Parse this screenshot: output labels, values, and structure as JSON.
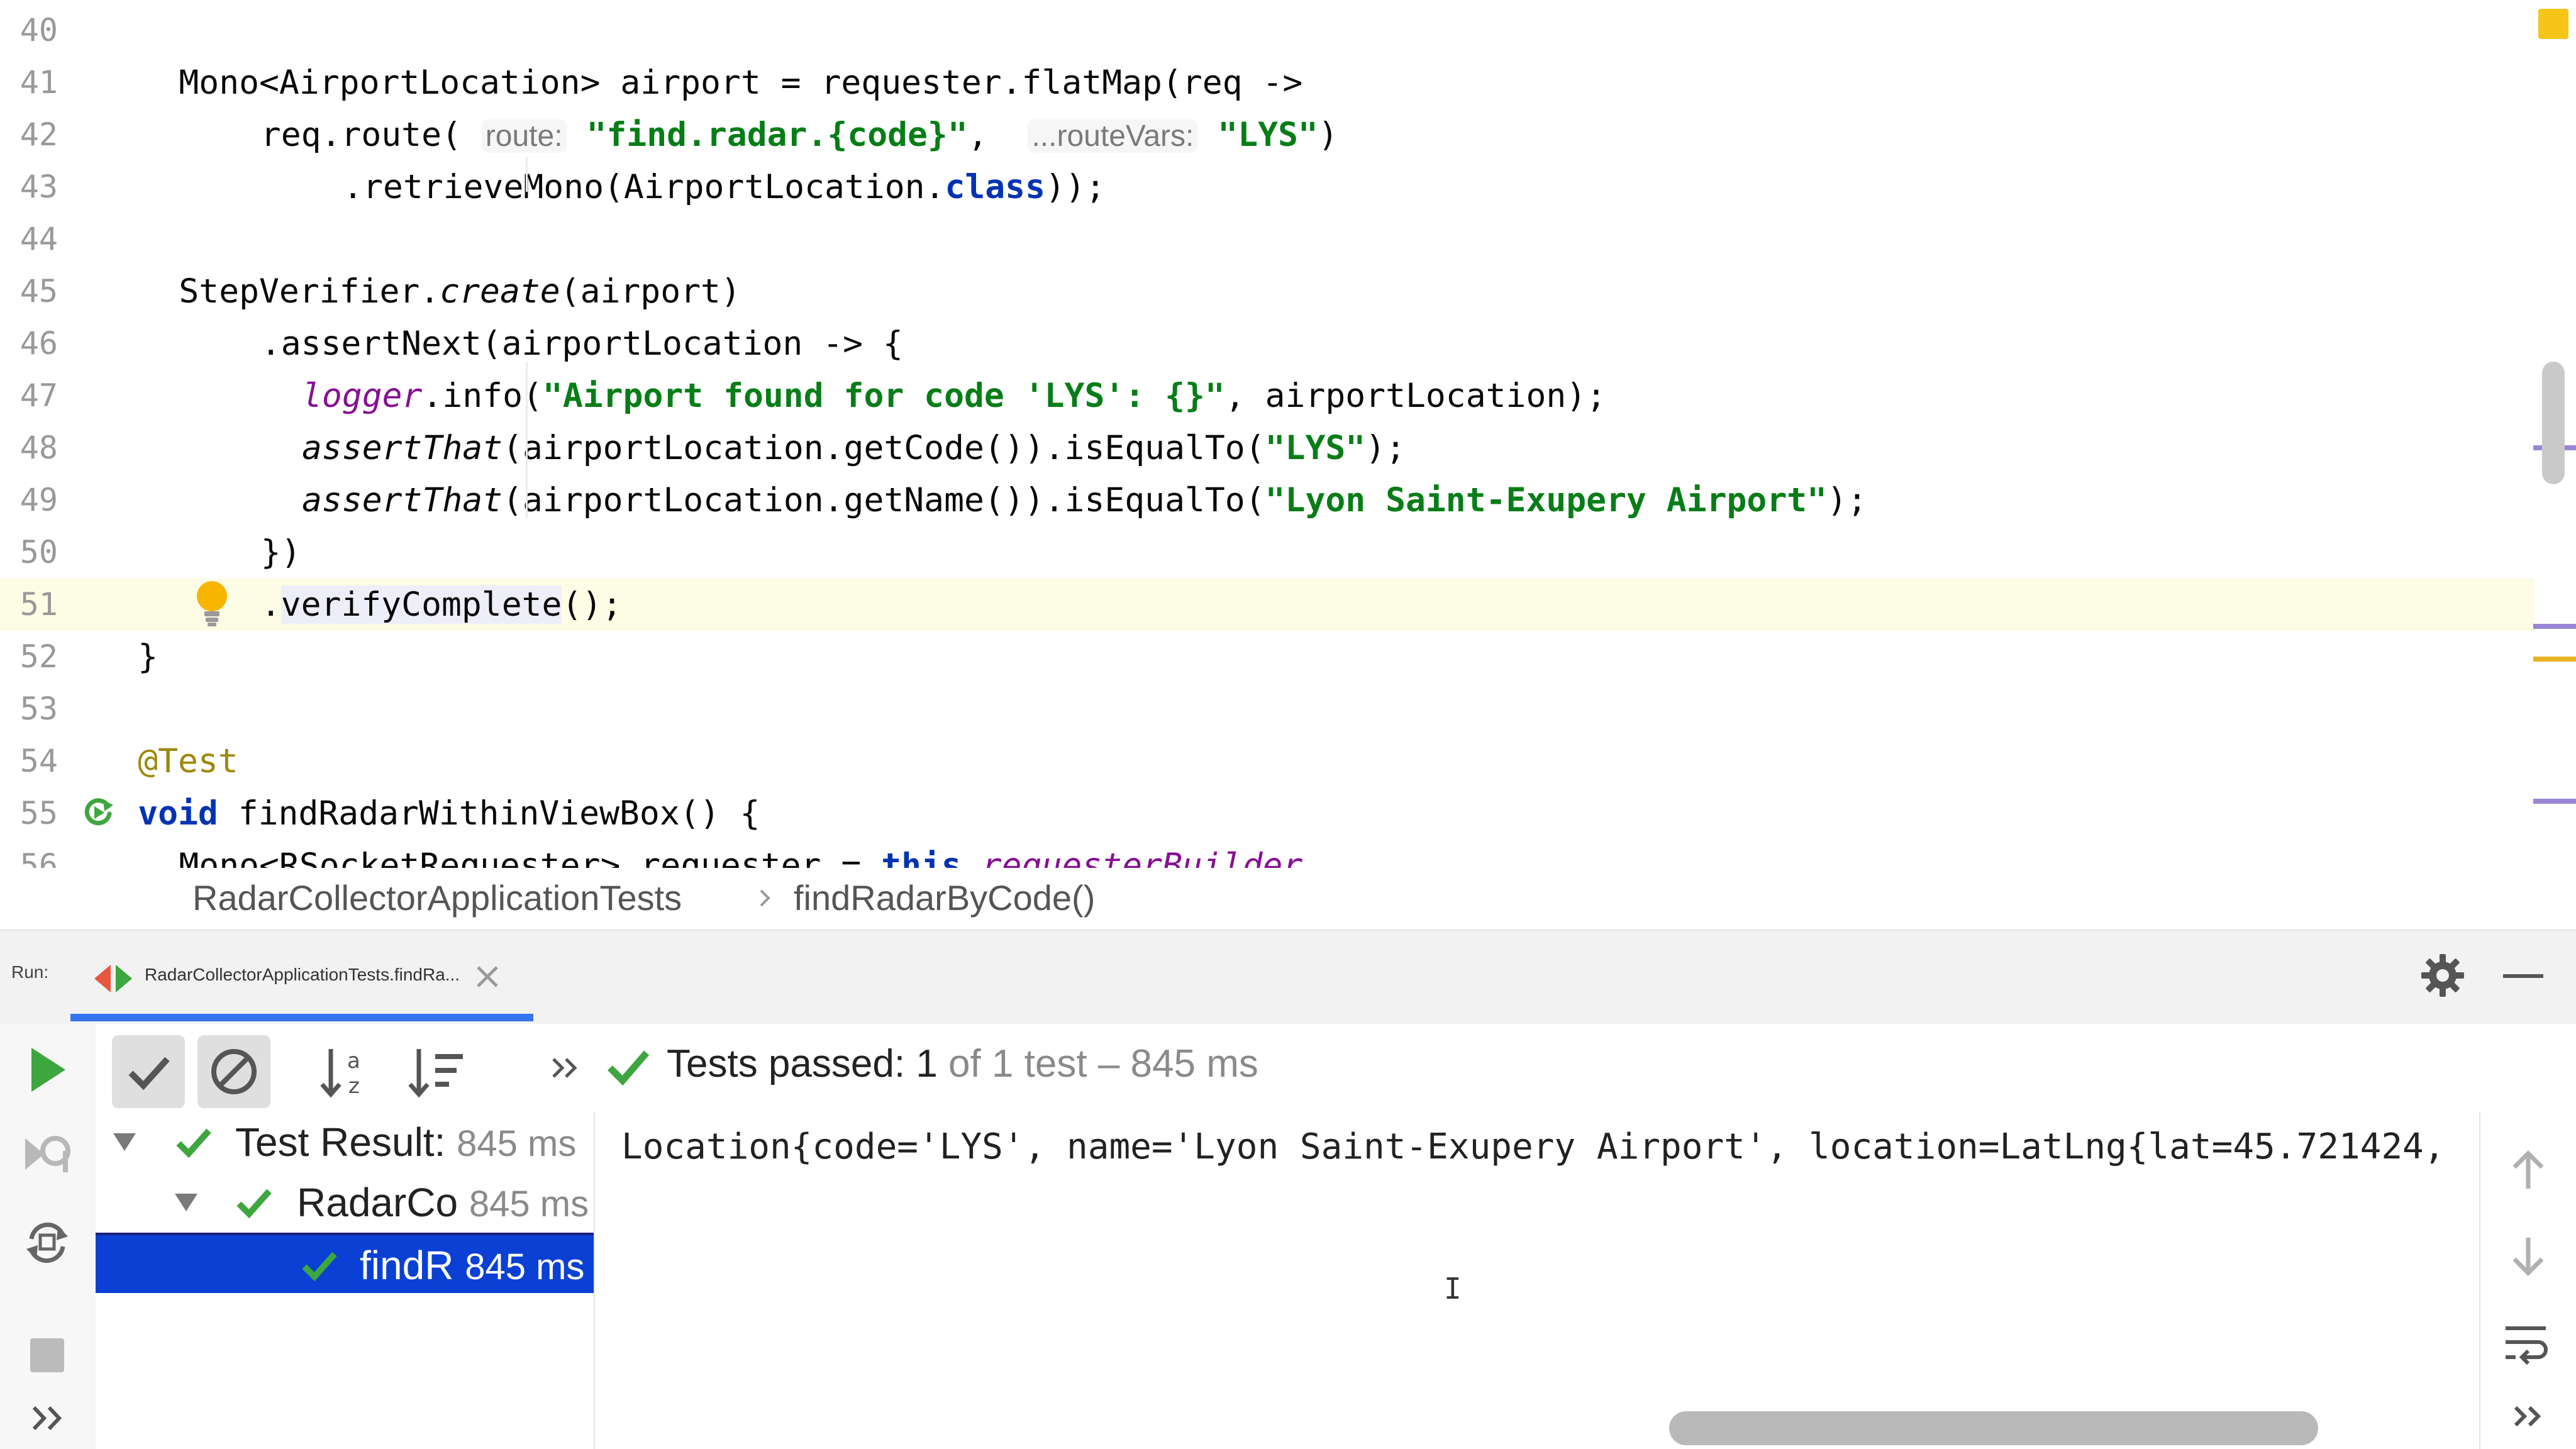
{
  "editor": {
    "lines": [
      {
        "n": "40",
        "indent": 0,
        "tokens": []
      },
      {
        "n": "41",
        "indent": 4,
        "tokens": [
          [
            "Mono<AirportLocation> airport = requester.flatMap(req ->",
            ""
          ]
        ]
      },
      {
        "n": "42",
        "indent": 8,
        "tokens": [
          [
            "req.route( ",
            ""
          ],
          [
            "route:",
            "hint"
          ],
          [
            " ",
            ""
          ],
          [
            "\"find.radar.{code}\"",
            "s"
          ],
          [
            ",  ",
            ""
          ],
          [
            "...routeVars:",
            "hint"
          ],
          [
            " ",
            ""
          ],
          [
            "\"LYS\"",
            "s"
          ],
          [
            ")",
            ""
          ]
        ]
      },
      {
        "n": "43",
        "indent": 12,
        "tokens": [
          [
            ".retrieveMono(AirportLocation.",
            ""
          ],
          [
            "class",
            "k"
          ],
          [
            "));",
            ""
          ]
        ]
      },
      {
        "n": "44",
        "indent": 0,
        "tokens": []
      },
      {
        "n": "45",
        "indent": 4,
        "tokens": [
          [
            "StepVerifier.",
            ""
          ],
          [
            "create",
            "it"
          ],
          [
            "(airport)",
            ""
          ]
        ]
      },
      {
        "n": "46",
        "indent": 8,
        "tokens": [
          [
            ".assertNext(airportLocation -> {",
            ""
          ]
        ]
      },
      {
        "n": "47",
        "indent": 10,
        "tokens": [
          [
            "logger",
            "lg"
          ],
          [
            ".info(",
            ""
          ],
          [
            "\"Airport found for code 'LYS': {}\"",
            "s"
          ],
          [
            ", airportLocation);",
            ""
          ]
        ]
      },
      {
        "n": "48",
        "indent": 10,
        "tokens": [
          [
            "assertThat",
            "it"
          ],
          [
            "(airportLocation.getCode()).isEqualTo(",
            ""
          ],
          [
            "\"LYS\"",
            "s"
          ],
          [
            ");",
            ""
          ]
        ]
      },
      {
        "n": "49",
        "indent": 10,
        "tokens": [
          [
            "assertThat",
            "it"
          ],
          [
            "(airportLocation.getName()).isEqualTo(",
            ""
          ],
          [
            "\"Lyon Saint-Exupery Airport\"",
            "s"
          ],
          [
            ");",
            ""
          ]
        ]
      },
      {
        "n": "50",
        "indent": 8,
        "tokens": [
          [
            "})",
            ""
          ]
        ]
      },
      {
        "n": "51",
        "indent": 8,
        "tokens": [
          [
            ".",
            ""
          ],
          [
            "verifyComplete",
            "hl"
          ],
          [
            "();",
            ""
          ]
        ],
        "current": true
      },
      {
        "n": "52",
        "indent": 2,
        "tokens": [
          [
            "}",
            ""
          ]
        ]
      },
      {
        "n": "53",
        "indent": 0,
        "tokens": []
      },
      {
        "n": "54",
        "indent": 2,
        "tokens": [
          [
            "@Test",
            "ann"
          ]
        ]
      },
      {
        "n": "55",
        "indent": 2,
        "tokens": [
          [
            "void",
            "k"
          ],
          [
            " findRadarWithinViewBox() {",
            ""
          ]
        ]
      },
      {
        "n": "56",
        "indent": 4,
        "tokens": [
          [
            "Mono<RSocketRequester> requester = ",
            ""
          ],
          [
            "this",
            "k"
          ],
          [
            ".",
            ""
          ],
          [
            "requesterBuilder",
            "lg"
          ]
        ]
      }
    ]
  },
  "breadcrumb": {
    "class_name": "RadarCollectorApplicationTests",
    "method_name": "findRadarByCode()"
  },
  "run_window": {
    "label": "Run:",
    "tab_title": "RadarCollectorApplicationTests.findRa...",
    "status": {
      "prefix": "Tests passed: ",
      "passed": "1",
      "suffix": " of 1 test – 845 ms"
    },
    "tree": [
      {
        "label": "Test Result:",
        "time": "845 ms"
      },
      {
        "label": "RadarCo",
        "time": "845 ms"
      },
      {
        "label": "findR",
        "time": "845 ms"
      }
    ],
    "console_line": "Location{code='LYS', name='Lyon Saint-Exupery Airport', location=LatLng{lat=45.721424,",
    "cursor_glyph": "I"
  },
  "icons": [
    "play-icon",
    "check-icon",
    "cancel-icon",
    "sort-alpha-icon",
    "sort-duration-icon",
    "chevrons-right-icon",
    "gear-icon",
    "minimize-icon",
    "rerun-failed-icon",
    "toggle-auto-test-icon",
    "stop-icon",
    "arrow-up-icon",
    "arrow-down-icon",
    "soft-wrap-icon",
    "lightbulb-icon",
    "run-gutter-icon",
    "close-icon"
  ],
  "colors": {
    "keyword": "#0033b3",
    "string": "#067d17",
    "selection": "#0b40d4",
    "pass": "#3ea63e",
    "tab_underline": "#3574f0"
  }
}
